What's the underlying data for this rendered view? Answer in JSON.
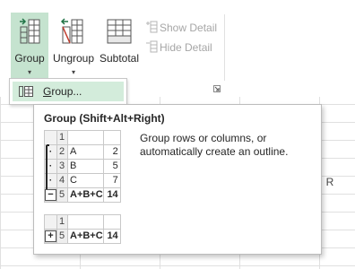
{
  "ribbon": {
    "group_label": "Group",
    "ungroup_label": "Ungroup",
    "subtotal_label": "Subtotal",
    "show_detail_label": "Show Detail",
    "hide_detail_label": "Hide Detail",
    "dropdown_arrow": "▾"
  },
  "menu": {
    "item_group_prefix": "G",
    "item_group_rest": "roup..."
  },
  "tooltip": {
    "title": "Group (Shift+Alt+Right)",
    "description": "Group rows or columns, or automatically create an outline.",
    "example_top": {
      "rows": [
        {
          "num": "1",
          "a": "",
          "b": "",
          "outline": ""
        },
        {
          "num": "2",
          "a": "A",
          "b": "2",
          "outline": "·"
        },
        {
          "num": "3",
          "a": "B",
          "b": "5",
          "outline": "·"
        },
        {
          "num": "4",
          "a": "C",
          "b": "7",
          "outline": "·"
        },
        {
          "num": "5",
          "a": "A+B+C",
          "b": "14",
          "outline": "−"
        }
      ]
    },
    "example_bottom": {
      "rows": [
        {
          "num": "1",
          "a": "",
          "b": "",
          "outline": ""
        },
        {
          "num": "5",
          "a": "A+B+C",
          "b": "14",
          "outline": "+"
        }
      ]
    }
  },
  "grid": {
    "column_header": "R"
  },
  "colors": {
    "accent_green": "#217346",
    "selected_button": "#c5e3cf",
    "menu_hover": "#d3ecdb"
  }
}
